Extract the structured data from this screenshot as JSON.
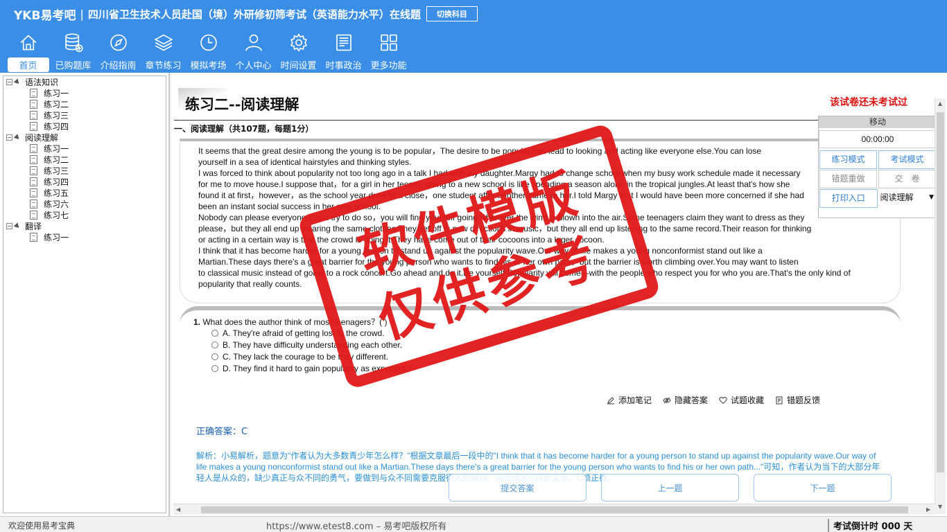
{
  "header": {
    "logo": "YKB易考吧",
    "separator": "|",
    "app_title": "四川省卫生技术人员赴国（境）外研修初筛考试（英语能力水平）在线题",
    "switch_label": "切换科目",
    "nav": [
      {
        "label": "首页",
        "icon": "home-icon"
      },
      {
        "label": "已购题库",
        "icon": "database-icon"
      },
      {
        "label": "介绍指南",
        "icon": "compass-icon"
      },
      {
        "label": "章节练习",
        "icon": "layers-icon"
      },
      {
        "label": "模拟考场",
        "icon": "clock-icon"
      },
      {
        "label": "个人中心",
        "icon": "user-icon"
      },
      {
        "label": "时间设置",
        "icon": "gear-icon"
      },
      {
        "label": "时事政治",
        "icon": "news-icon"
      },
      {
        "label": "更多功能",
        "icon": "grid-icon"
      }
    ]
  },
  "sidebar": {
    "groups": [
      {
        "label": "语法知识",
        "items": [
          "练习一",
          "练习二",
          "练习三",
          "练习四"
        ]
      },
      {
        "label": "阅读理解",
        "items": [
          "练习一",
          "练习二",
          "练习三",
          "练习四",
          "练习五",
          "练习六",
          "练习七"
        ]
      },
      {
        "label": "翻译",
        "items": [
          "练习一"
        ]
      }
    ]
  },
  "main": {
    "exercise_title": "练习二--阅读理解",
    "not_tested": "该试卷还未考试过",
    "section_head": "一、阅读理解（共107题，每题1分）",
    "passage": "It seems that the great desire among the young is to be popular，The desire to be popular can lead to looking and acting like everyone else.You can lose\nyourself in a sea of identical hairstyles and thinking styles.\nI was forced to think about popularity not too long ago in a talk I had with my daughter.Margy had to change school when my busy work schedule made it necessary\nfor me to move house.I suppose that，for a girl in her teens，going to a new school is like spending a season alone in the tropical jungles.At least that's how she\nfound it at first，however，as the school year drew to a close，one student after another came to her.I told Margy that I would have been more concerned if she had\nbeen an instant social success in her new school.\nNobody can please everyone.If you try to do so，you will find yourself going wherever the wind is blown into the air.Some teenagers claim they want to dress as they\nplease，but they all end up wearing the same clothes.They set off in new directions in music，but they all end up listening to the same record.Their reason for thinking\nor acting in a certain way is that the crowd is doing it.They have come out of their cocoons into a lager cocoon.\nI think that it has become harder for a young person to stand up against the popularity wave.Our way of life makes a young nonconformist stand out like a\nMartian.These days there's a great barrier for the young person who wants to find his or her own path，but the barrier is worth climbing over.You may want to listen\nto classical music instead of going to a rock concert.Go ahead and do it.Be yourself.Popularity will come—with the people who respect you for who you are.That's the only kind of\npopularity that really counts.",
    "question": {
      "number": "1.",
      "stem": "What does the author think of most teenagers？(  )",
      "options": [
        "A. They're afraid of getting lost in the crowd.",
        "B. They have difficulty understanding each other.",
        "C. They lack the courage to be truly different.",
        "D. They find it hard to gain popularity as expected."
      ]
    },
    "tools": [
      "添加笔记",
      "隐藏答案",
      "试题收藏",
      "错题反馈"
    ],
    "answer": "正确答案：C",
    "analysis": "解析：小易解析，题意为\"作者认为大多数青少年怎么样？\"根据文章最后一段中的\"I think that it has become harder for a young person to stand up against the popularity wave.Our way of life makes a young nonconformist stand out like a Martian.These days there's a great barrier for the young person who wants to find his or her own path...\"可知，作者认为当下的大部分年轻人是从众的，缺少真正与众不同的勇气，要做到与众不同需要克服很大的障碍。因此选项C符合文意。C项正确。",
    "buttons": {
      "submit": "提交答案",
      "prev": "上一题",
      "next": "下一题"
    }
  },
  "control_panel": {
    "move": "移动",
    "timer": "00:00:00",
    "practice_mode": "练习模式",
    "exam_mode": "考试模式",
    "redo_wrong": "错题重做",
    "submit_paper": "交　卷",
    "print_entry": "打印入口",
    "mode_select": "阅读理解"
  },
  "watermark": {
    "line1": "软件模版",
    "line2": "仅供参考"
  },
  "status": {
    "left": "欢迎使用易考宝典",
    "center": "https://www.etest8.com – 易考吧版权所有",
    "right": "考试倒计时 000 天"
  }
}
